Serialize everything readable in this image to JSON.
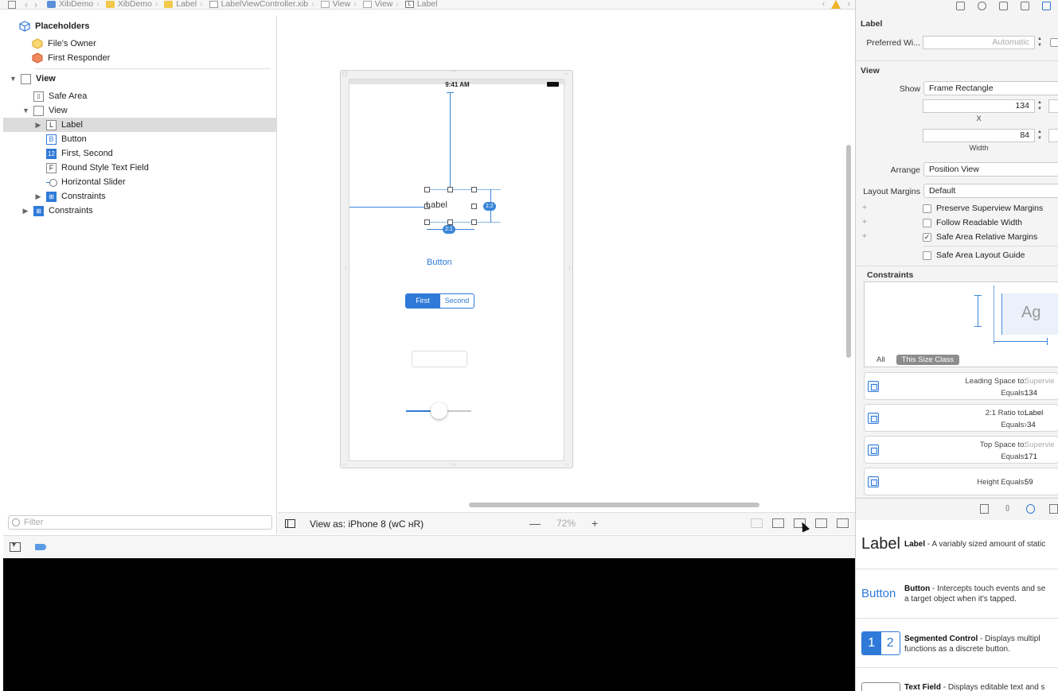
{
  "breadcrumbs": [
    "XibDemo",
    "XibDemo",
    "Label",
    "LabelViewController.xib",
    "View",
    "View",
    "Label"
  ],
  "outline": {
    "placeholders": "Placeholders",
    "files_owner": "File's Owner",
    "first_responder": "First Responder",
    "view": "View",
    "safe_area": "Safe Area",
    "subview": "View",
    "label": "Label",
    "button": "Button",
    "segmented": "First, Second",
    "textfield": "Round Style Text Field",
    "slider": "Horizontal Slider",
    "constraints_inner": "Constraints",
    "constraints_outer": "Constraints",
    "filter_placeholder": "Filter"
  },
  "canvas": {
    "status_time": "9:41 AM",
    "label_text": "Label",
    "ratio_badge": "1:2",
    "width_badge": "2:1",
    "button_text": "Button",
    "seg_first": "First",
    "seg_second": "Second",
    "slider_value": 0.5
  },
  "canvas_bar": {
    "view_as": "View as: iPhone 8 (ᴡC ʜR)",
    "zoom_out": "—",
    "zoom": "72%",
    "zoom_in": "+"
  },
  "inspector": {
    "label_section": "Label",
    "preferred_width_label": "Preferred Wi...",
    "preferred_width_placeholder": "Automatic",
    "view_section": "View",
    "show_label": "Show",
    "show_value": "Frame Rectangle",
    "x_value": "134",
    "x_caption": "X",
    "width_value": "84",
    "width_caption": "Width",
    "arrange_label": "Arrange",
    "arrange_value": "Position View",
    "layout_margins_label": "Layout Margins",
    "layout_margins_value": "Default",
    "chk_preserve": "Preserve Superview Margins",
    "chk_readable": "Follow Readable Width",
    "chk_safe_margins": "Safe Area Relative Margins",
    "chk_safe_guide": "Safe Area Layout Guide",
    "safe_margins_checked": "✓",
    "constraints_section": "Constraints",
    "ag_text": "Ag",
    "tab_all": "All",
    "tab_size_class": "This Size Class",
    "c1_label": "Leading Space to:",
    "c1_target": "Supervie",
    "c1_equals_label": "Equals:",
    "c1_equals": "134",
    "c2_label": "2:1 Ratio to:",
    "c2_target": "Label",
    "c2_equals_label": "Equals:",
    "c2_equals": "-34",
    "c3_label": "Top Space to:",
    "c3_target": "Supervie",
    "c3_equals_label": "Equals:",
    "c3_equals": "171",
    "c4_label": "Height Equals:",
    "c4_equals": "59"
  },
  "library": {
    "tab_code": "{}",
    "label_big": "Label",
    "label_name": "Label",
    "label_desc": " - A variably sized amount of static",
    "button_big": "Button",
    "button_name": "Button",
    "button_desc": " - Intercepts touch events and se",
    "button_desc2": "a target object when it's tapped.",
    "seg_a": "1",
    "seg_b": "2",
    "seg_name": "Segmented Control",
    "seg_desc": " - Displays multipl",
    "seg_desc2": "functions as a discrete button.",
    "tf_name": "Text Field",
    "tf_desc": " - Displays editable text and s"
  },
  "colors": {
    "accent": "#2f7ad8",
    "constraint": "#3a86d7",
    "warning": "#f0b429"
  }
}
